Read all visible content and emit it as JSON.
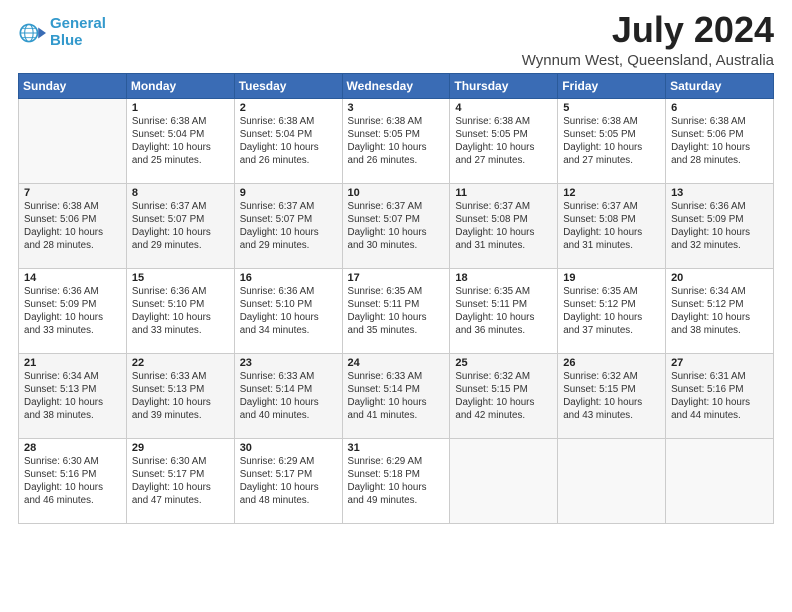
{
  "header": {
    "logo_line1": "General",
    "logo_line2": "Blue",
    "title": "July 2024",
    "subtitle": "Wynnum West, Queensland, Australia"
  },
  "days_of_week": [
    "Sunday",
    "Monday",
    "Tuesday",
    "Wednesday",
    "Thursday",
    "Friday",
    "Saturday"
  ],
  "weeks": [
    [
      {
        "num": "",
        "info": ""
      },
      {
        "num": "1",
        "info": "Sunrise: 6:38 AM\nSunset: 5:04 PM\nDaylight: 10 hours\nand 25 minutes."
      },
      {
        "num": "2",
        "info": "Sunrise: 6:38 AM\nSunset: 5:04 PM\nDaylight: 10 hours\nand 26 minutes."
      },
      {
        "num": "3",
        "info": "Sunrise: 6:38 AM\nSunset: 5:05 PM\nDaylight: 10 hours\nand 26 minutes."
      },
      {
        "num": "4",
        "info": "Sunrise: 6:38 AM\nSunset: 5:05 PM\nDaylight: 10 hours\nand 27 minutes."
      },
      {
        "num": "5",
        "info": "Sunrise: 6:38 AM\nSunset: 5:05 PM\nDaylight: 10 hours\nand 27 minutes."
      },
      {
        "num": "6",
        "info": "Sunrise: 6:38 AM\nSunset: 5:06 PM\nDaylight: 10 hours\nand 28 minutes."
      }
    ],
    [
      {
        "num": "7",
        "info": "Sunrise: 6:38 AM\nSunset: 5:06 PM\nDaylight: 10 hours\nand 28 minutes."
      },
      {
        "num": "8",
        "info": "Sunrise: 6:37 AM\nSunset: 5:07 PM\nDaylight: 10 hours\nand 29 minutes."
      },
      {
        "num": "9",
        "info": "Sunrise: 6:37 AM\nSunset: 5:07 PM\nDaylight: 10 hours\nand 29 minutes."
      },
      {
        "num": "10",
        "info": "Sunrise: 6:37 AM\nSunset: 5:07 PM\nDaylight: 10 hours\nand 30 minutes."
      },
      {
        "num": "11",
        "info": "Sunrise: 6:37 AM\nSunset: 5:08 PM\nDaylight: 10 hours\nand 31 minutes."
      },
      {
        "num": "12",
        "info": "Sunrise: 6:37 AM\nSunset: 5:08 PM\nDaylight: 10 hours\nand 31 minutes."
      },
      {
        "num": "13",
        "info": "Sunrise: 6:36 AM\nSunset: 5:09 PM\nDaylight: 10 hours\nand 32 minutes."
      }
    ],
    [
      {
        "num": "14",
        "info": "Sunrise: 6:36 AM\nSunset: 5:09 PM\nDaylight: 10 hours\nand 33 minutes."
      },
      {
        "num": "15",
        "info": "Sunrise: 6:36 AM\nSunset: 5:10 PM\nDaylight: 10 hours\nand 33 minutes."
      },
      {
        "num": "16",
        "info": "Sunrise: 6:36 AM\nSunset: 5:10 PM\nDaylight: 10 hours\nand 34 minutes."
      },
      {
        "num": "17",
        "info": "Sunrise: 6:35 AM\nSunset: 5:11 PM\nDaylight: 10 hours\nand 35 minutes."
      },
      {
        "num": "18",
        "info": "Sunrise: 6:35 AM\nSunset: 5:11 PM\nDaylight: 10 hours\nand 36 minutes."
      },
      {
        "num": "19",
        "info": "Sunrise: 6:35 AM\nSunset: 5:12 PM\nDaylight: 10 hours\nand 37 minutes."
      },
      {
        "num": "20",
        "info": "Sunrise: 6:34 AM\nSunset: 5:12 PM\nDaylight: 10 hours\nand 38 minutes."
      }
    ],
    [
      {
        "num": "21",
        "info": "Sunrise: 6:34 AM\nSunset: 5:13 PM\nDaylight: 10 hours\nand 38 minutes."
      },
      {
        "num": "22",
        "info": "Sunrise: 6:33 AM\nSunset: 5:13 PM\nDaylight: 10 hours\nand 39 minutes."
      },
      {
        "num": "23",
        "info": "Sunrise: 6:33 AM\nSunset: 5:14 PM\nDaylight: 10 hours\nand 40 minutes."
      },
      {
        "num": "24",
        "info": "Sunrise: 6:33 AM\nSunset: 5:14 PM\nDaylight: 10 hours\nand 41 minutes."
      },
      {
        "num": "25",
        "info": "Sunrise: 6:32 AM\nSunset: 5:15 PM\nDaylight: 10 hours\nand 42 minutes."
      },
      {
        "num": "26",
        "info": "Sunrise: 6:32 AM\nSunset: 5:15 PM\nDaylight: 10 hours\nand 43 minutes."
      },
      {
        "num": "27",
        "info": "Sunrise: 6:31 AM\nSunset: 5:16 PM\nDaylight: 10 hours\nand 44 minutes."
      }
    ],
    [
      {
        "num": "28",
        "info": "Sunrise: 6:30 AM\nSunset: 5:16 PM\nDaylight: 10 hours\nand 46 minutes."
      },
      {
        "num": "29",
        "info": "Sunrise: 6:30 AM\nSunset: 5:17 PM\nDaylight: 10 hours\nand 47 minutes."
      },
      {
        "num": "30",
        "info": "Sunrise: 6:29 AM\nSunset: 5:17 PM\nDaylight: 10 hours\nand 48 minutes."
      },
      {
        "num": "31",
        "info": "Sunrise: 6:29 AM\nSunset: 5:18 PM\nDaylight: 10 hours\nand 49 minutes."
      },
      {
        "num": "",
        "info": ""
      },
      {
        "num": "",
        "info": ""
      },
      {
        "num": "",
        "info": ""
      }
    ]
  ]
}
